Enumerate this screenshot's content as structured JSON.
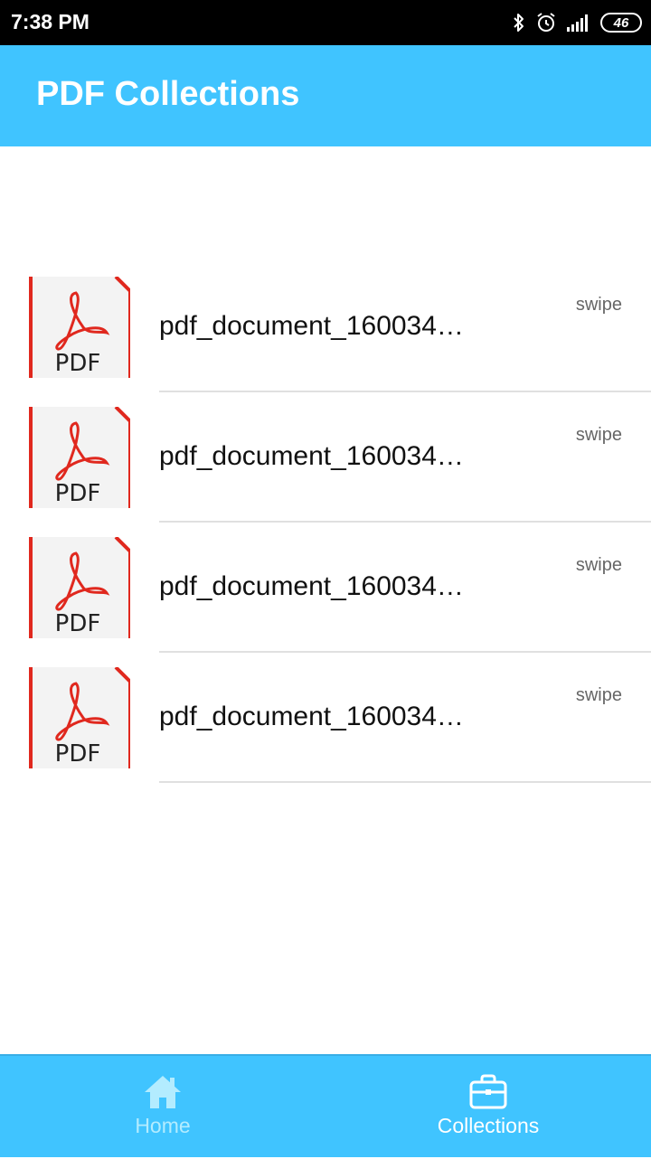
{
  "status_bar": {
    "time": "7:38 PM",
    "battery": "46",
    "icons": [
      "bluetooth-icon",
      "alarm-icon",
      "signal-icon",
      "battery-icon"
    ]
  },
  "app_bar": {
    "title": "PDF Collections"
  },
  "list": {
    "items": [
      {
        "title": "pdf_document_160034…",
        "hint": "swipe",
        "icon_label": "PDF",
        "icon": "pdf-file-icon"
      },
      {
        "title": "pdf_document_160034…",
        "hint": "swipe",
        "icon_label": "PDF",
        "icon": "pdf-file-icon"
      },
      {
        "title": "pdf_document_160034…",
        "hint": "swipe",
        "icon_label": "PDF",
        "icon": "pdf-file-icon"
      },
      {
        "title": "pdf_document_160034…",
        "hint": "swipe",
        "icon_label": "PDF",
        "icon": "pdf-file-icon"
      }
    ]
  },
  "bottom_nav": {
    "items": [
      {
        "label": "Home",
        "icon": "home-icon",
        "selected": false
      },
      {
        "label": "Collections",
        "icon": "briefcase-icon",
        "selected": true
      }
    ]
  },
  "colors": {
    "primary": "#40c4ff",
    "pdf_red": "#e0281e",
    "inactive_nav": "#b3ecff"
  }
}
